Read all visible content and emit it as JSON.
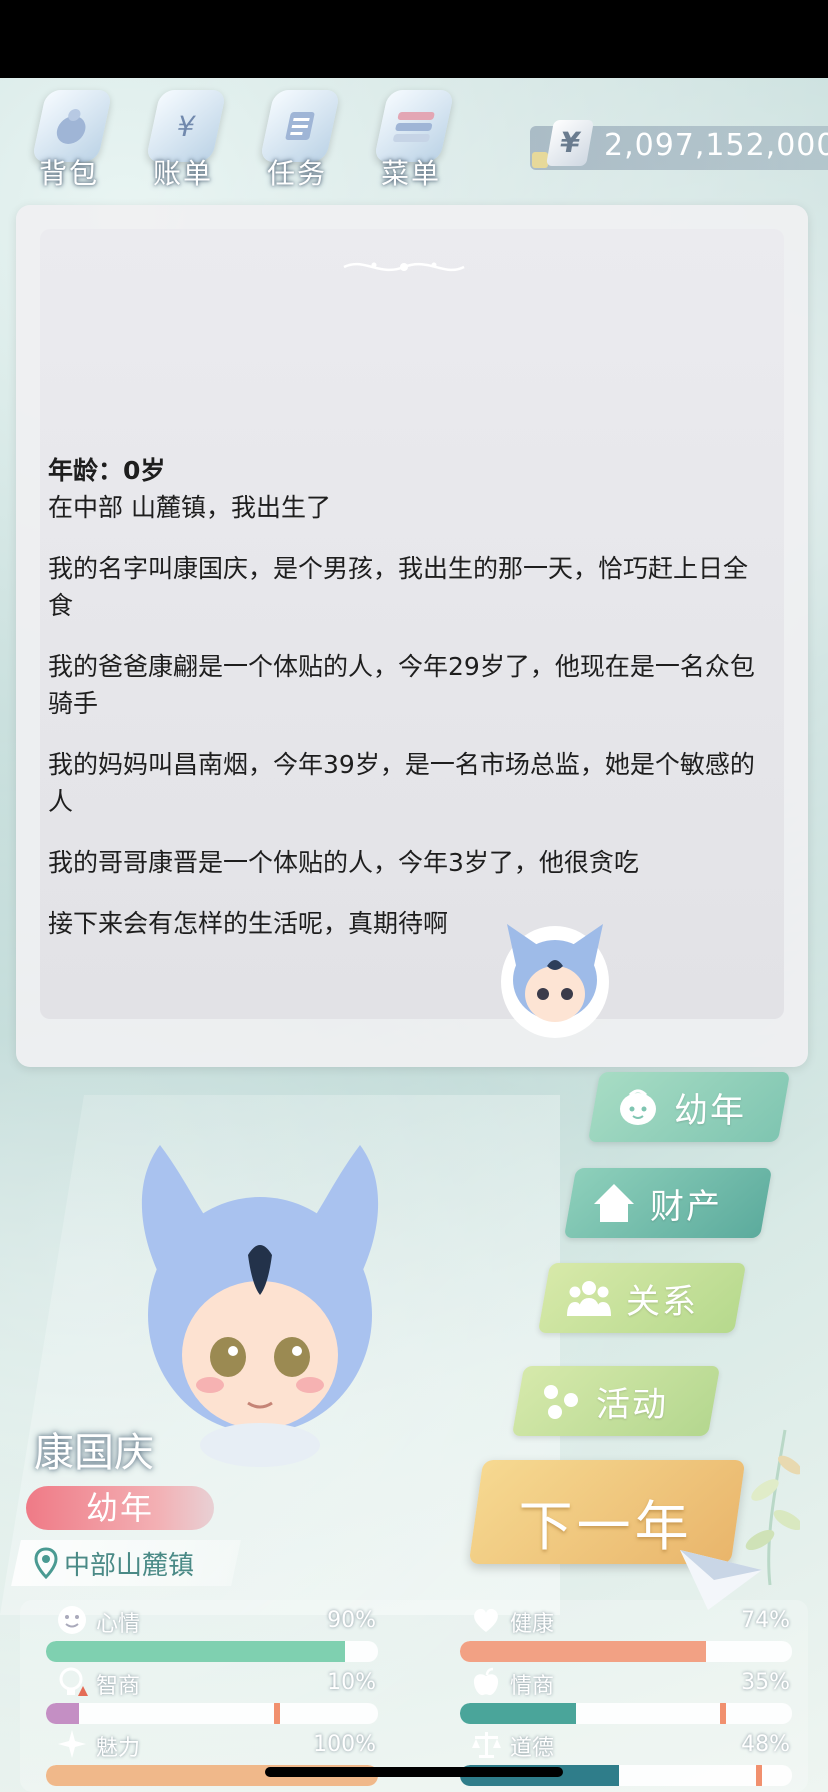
{
  "menu": [
    {
      "label": "背包",
      "icon": "bag-icon"
    },
    {
      "label": "账单",
      "icon": "bill-icon"
    },
    {
      "label": "任务",
      "icon": "task-icon"
    },
    {
      "label": "菜单",
      "icon": "menu-book-icon"
    }
  ],
  "money": {
    "symbol": "¥",
    "value": "2,097,152,000"
  },
  "story": {
    "age_line": "年龄：0岁",
    "paragraphs": [
      "在中部 山麓镇，我出生了",
      "我的名字叫康国庆，是个男孩，我出生的那一天，恰巧赶上日全食",
      "我的爸爸康翩是一个体贴的人，今年29岁了，他现在是一名众包骑手",
      "我的妈妈叫昌南烟，今年39岁，是一名市场总监，她是个敏感的人",
      "我的哥哥康晋是一个体贴的人，今年3岁了，他很贪吃",
      "接下来会有怎样的生活呢，真期待啊"
    ]
  },
  "side_buttons": [
    {
      "label": "幼年",
      "icon": "baby-face-icon",
      "color": "#8ccdb4"
    },
    {
      "label": "财产",
      "icon": "house-icon",
      "color": "#7cc4b1"
    },
    {
      "label": "关系",
      "icon": "people-icon",
      "color": "#c5e09a"
    },
    {
      "label": "活动",
      "icon": "dots-icon",
      "color": "#c6e0a0"
    }
  ],
  "next_button": "下一年",
  "character": {
    "name": "康国庆",
    "stage": "幼年",
    "location": "中部山麓镇"
  },
  "stats": [
    {
      "label": "心情",
      "value": "90%",
      "level": 0.9,
      "icon": "smile-icon",
      "color": "#7fd0b0"
    },
    {
      "label": "健康",
      "value": "74%",
      "level": 0.74,
      "icon": "heart-icon",
      "color": "#f2a184"
    },
    {
      "label": "智商",
      "value": "10%",
      "level": 0.1,
      "icon": "bulb-icon",
      "color": "#c48fc4"
    },
    {
      "label": "情商",
      "value": "35%",
      "level": 0.35,
      "icon": "apple-icon",
      "color": "#4aa59a"
    },
    {
      "label": "魅力",
      "value": "100%",
      "level": 1.0,
      "icon": "sparkle-icon",
      "color": "#f0b88a"
    },
    {
      "label": "道德",
      "value": "48%",
      "level": 0.48,
      "icon": "scale-icon",
      "color": "#2f7d8a"
    }
  ]
}
